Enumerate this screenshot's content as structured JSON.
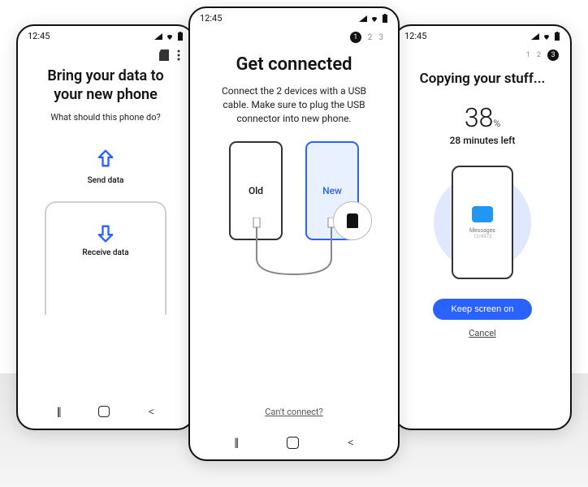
{
  "status_time": "12:45",
  "left": {
    "title_l1": "Bring your data to",
    "title_l2": "your new phone",
    "subtitle": "What should this phone do?",
    "send_label": "Send data",
    "receive_label": "Receive data"
  },
  "center": {
    "steps": {
      "active": "1",
      "s2": "2",
      "s3": "3"
    },
    "title": "Get connected",
    "instructions": "Connect the 2 devices with a USB cable. Make sure to plug the USB connector into new phone.",
    "old_label": "Old",
    "new_label": "New",
    "cant_connect": "Can't connect?"
  },
  "right": {
    "steps": {
      "s1": "1",
      "s2": "2",
      "active": "3"
    },
    "title": "Copying your stuff...",
    "percent": "38",
    "percent_suffix": "%",
    "remaining": "28 minutes left",
    "item_label": "Messages",
    "item_count": "12/4372",
    "keep_on": "Keep screen on",
    "cancel": "Cancel"
  },
  "nav": {
    "recent": "|||",
    "home": "◯",
    "back": "<"
  }
}
